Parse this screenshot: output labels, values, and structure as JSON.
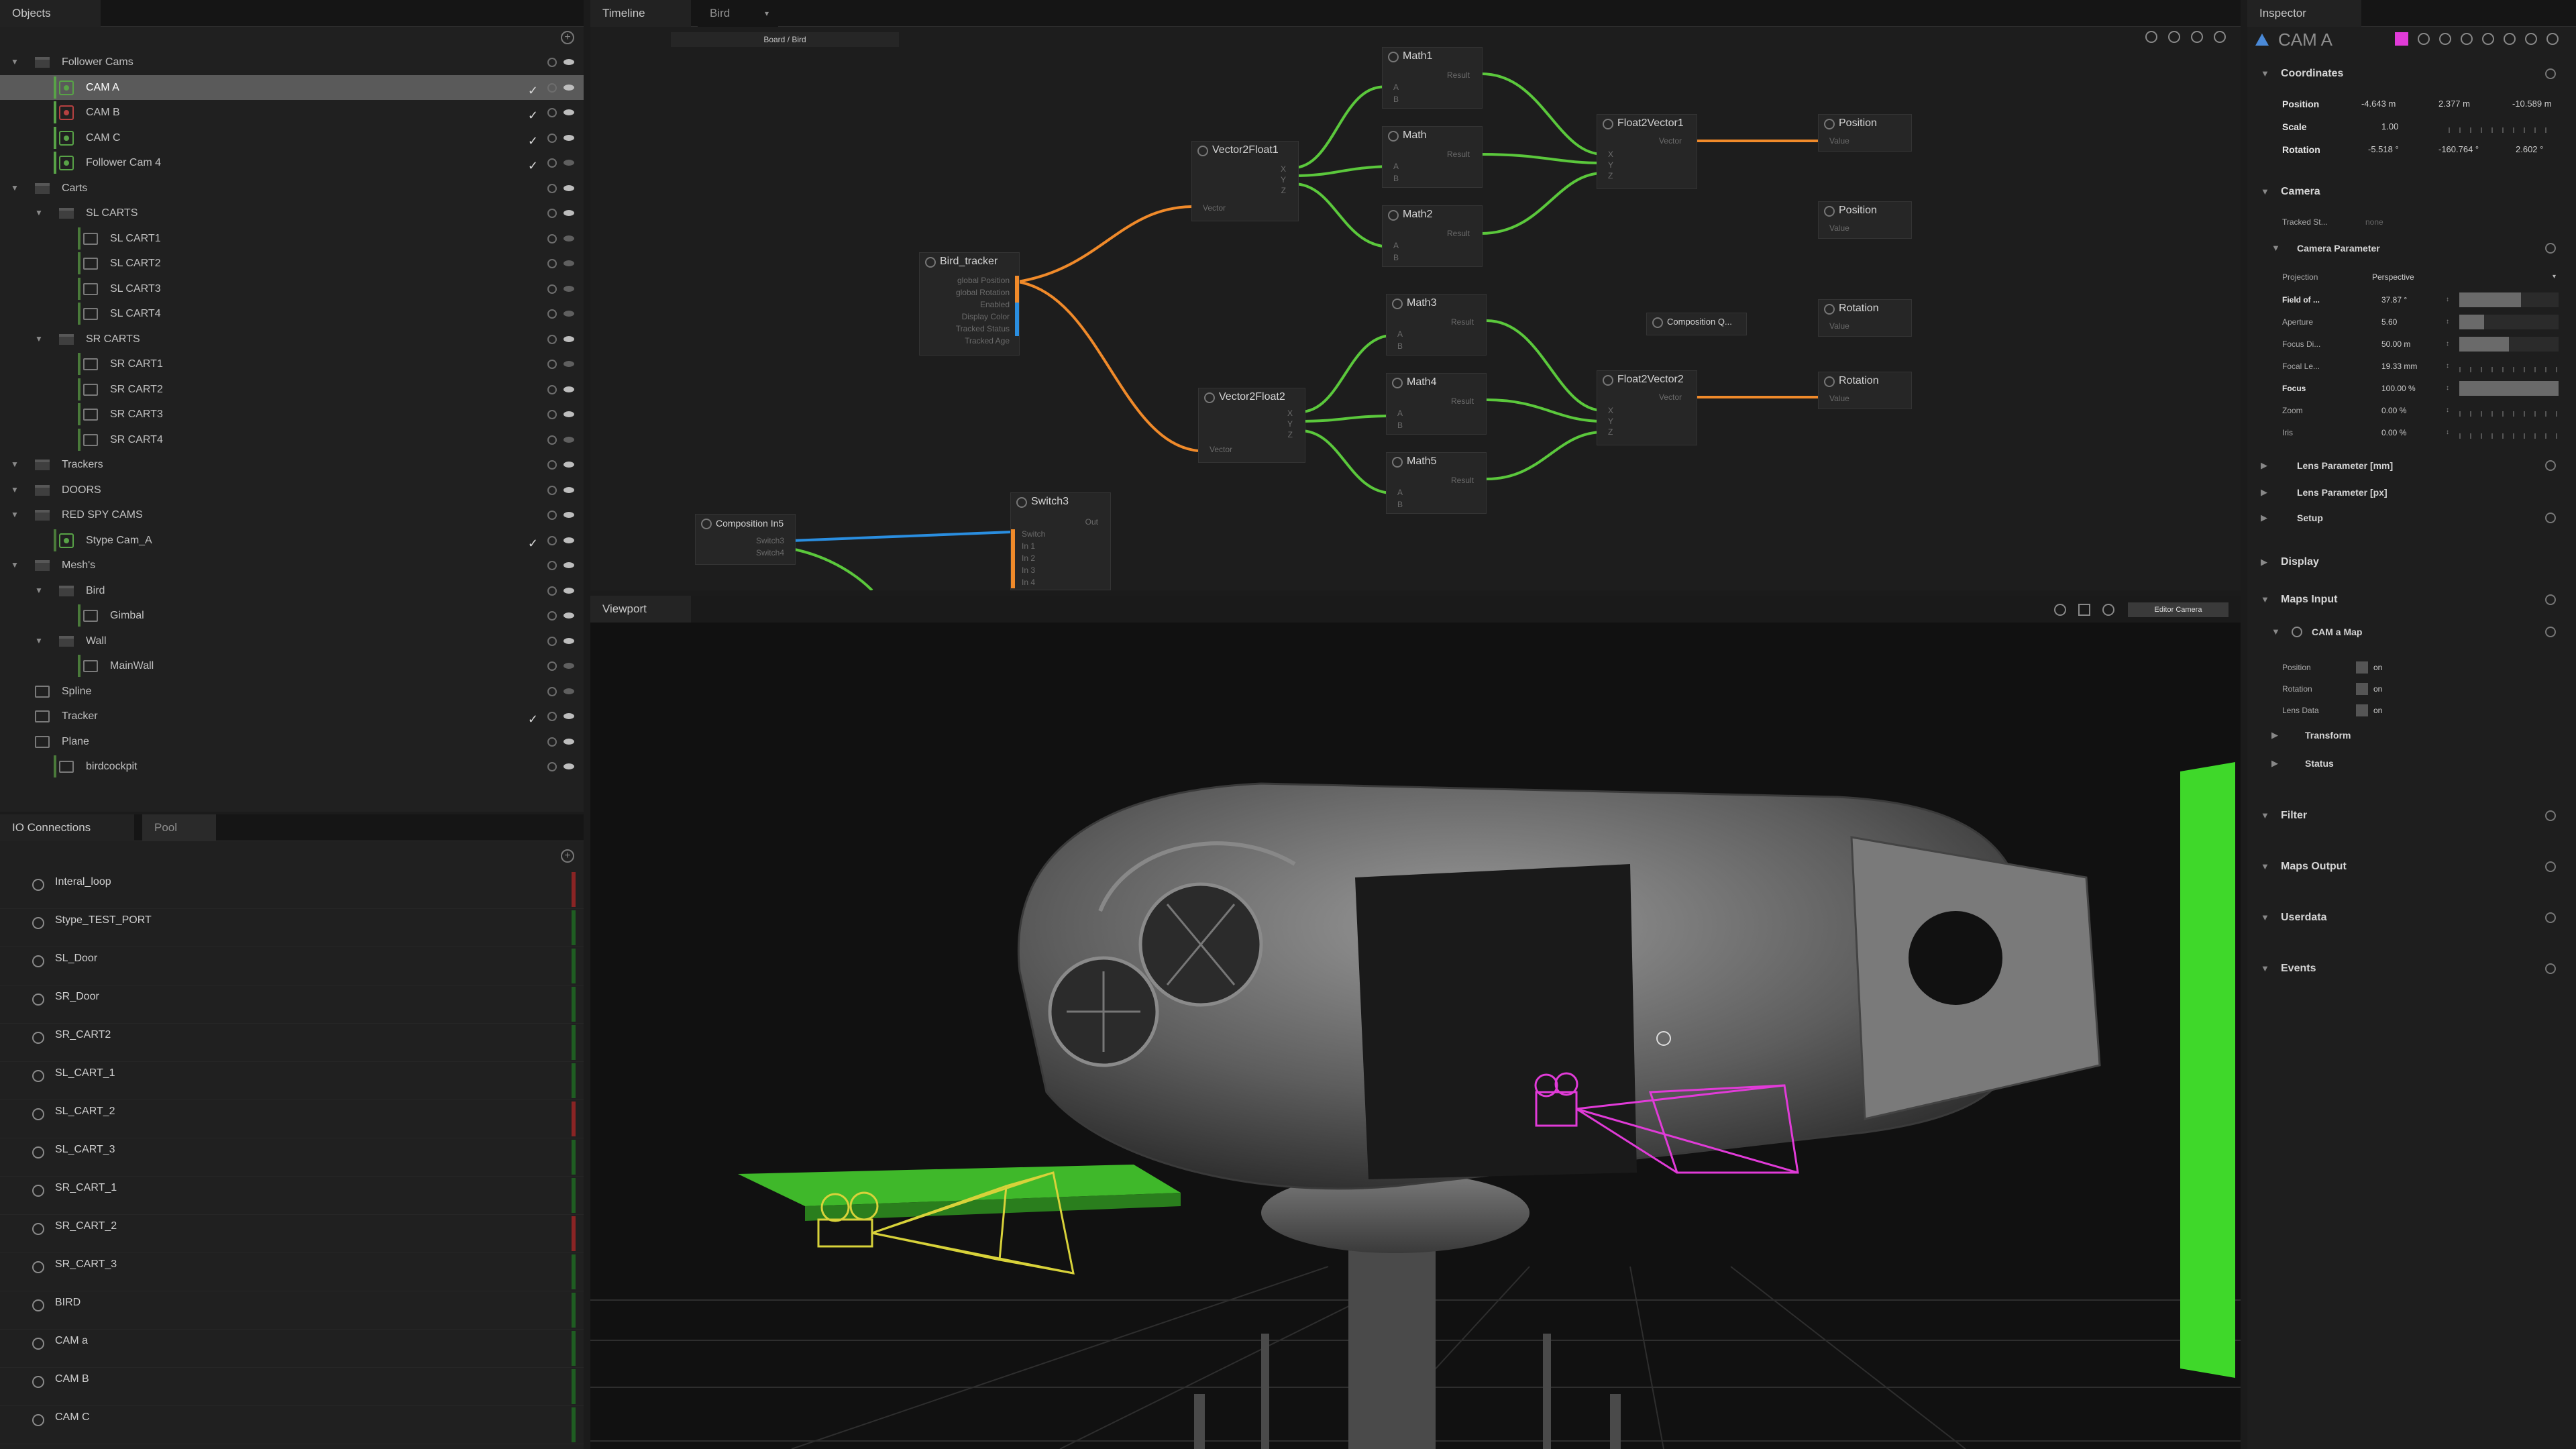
{
  "colors": {
    "accent_orange": "#f08a2a",
    "accent_green": "#5bc83c",
    "accent_blue": "#2a8ee0",
    "magenta": "#e13bd8",
    "selection": "#5a5a5a"
  },
  "objects": {
    "tab_label": "Objects",
    "add_icon": "plus-circle-icon",
    "rows": [
      {
        "label": "Follower Cams",
        "type": "folder"
      },
      {
        "label": "CAM A",
        "type": "camera",
        "selected": true
      },
      {
        "label": "CAM B",
        "type": "camera"
      },
      {
        "label": "CAM C",
        "type": "camera"
      },
      {
        "label": "Follower Cam 4",
        "type": "camera"
      },
      {
        "label": "Carts",
        "type": "folder"
      },
      {
        "label": "SL CARTS",
        "type": "folder"
      },
      {
        "label": "SL CART1",
        "type": "object"
      },
      {
        "label": "SL CART2",
        "type": "object"
      },
      {
        "label": "SL CART3",
        "type": "object"
      },
      {
        "label": "SL CART4",
        "type": "object"
      },
      {
        "label": "SR CARTS",
        "type": "folder"
      },
      {
        "label": "SR CART1",
        "type": "object"
      },
      {
        "label": "SR CART2",
        "type": "object"
      },
      {
        "label": "SR CART3",
        "type": "object"
      },
      {
        "label": "SR CART4",
        "type": "object"
      },
      {
        "label": "Trackers",
        "type": "folder"
      },
      {
        "label": "DOORS",
        "type": "folder"
      },
      {
        "label": "RED SPY CAMS",
        "type": "folder"
      },
      {
        "label": "Stype Cam_A",
        "type": "camera"
      },
      {
        "label": "Mesh's",
        "type": "folder"
      },
      {
        "label": "Bird",
        "type": "folder"
      },
      {
        "label": "Gimbal",
        "type": "object"
      },
      {
        "label": "Wall",
        "type": "folder"
      },
      {
        "label": "MainWall",
        "type": "object"
      },
      {
        "label": "Spline",
        "type": "spline"
      },
      {
        "label": "Tracker",
        "type": "tracker"
      },
      {
        "label": "Plane",
        "type": "plane"
      },
      {
        "label": "birdcockpit",
        "type": "object"
      }
    ]
  },
  "io": {
    "tab_connections": "IO Connections",
    "tab_pool": "Pool",
    "items": [
      {
        "label": "Interal_loop",
        "status": "red"
      },
      {
        "label": "Stype_TEST_PORT",
        "status": "green"
      },
      {
        "label": "SL_Door",
        "status": "green"
      },
      {
        "label": "SR_Door",
        "status": "green"
      },
      {
        "label": "SR_CART2",
        "status": "green"
      },
      {
        "label": "SL_CART_1",
        "status": "green"
      },
      {
        "label": "SL_CART_2",
        "status": "red"
      },
      {
        "label": "SL_CART_3",
        "status": "green"
      },
      {
        "label": "SR_CART_1",
        "status": "green"
      },
      {
        "label": "SR_CART_2",
        "status": "red"
      },
      {
        "label": "SR_CART_3",
        "status": "green"
      },
      {
        "label": "BIRD",
        "status": "green"
      },
      {
        "label": "CAM a",
        "status": "green"
      },
      {
        "label": "CAM B",
        "status": "green"
      },
      {
        "label": "CAM C",
        "status": "green"
      }
    ]
  },
  "timeline": {
    "tab_timeline": "Timeline",
    "tab_bird": "Bird",
    "breadcrumb": "Board / Bird",
    "nodes": {
      "math1": {
        "title": "Math1",
        "port_a": "A",
        "port_b": "B",
        "result": "Result"
      },
      "math": {
        "title": "Math",
        "port_a": "A",
        "port_b": "B",
        "result": "Result"
      },
      "math2": {
        "title": "Math2",
        "port_a": "A",
        "port_b": "B",
        "result": "Result"
      },
      "math3": {
        "title": "Math3",
        "port_a": "A",
        "port_b": "B",
        "result": "Result"
      },
      "math4": {
        "title": "Math4",
        "port_a": "A",
        "port_b": "B",
        "result": "Result"
      },
      "math5": {
        "title": "Math5",
        "port_a": "A",
        "port_b": "B",
        "result": "Result"
      },
      "v2f1": {
        "title": "Vector2Float1",
        "port": "Vector",
        "x": "X",
        "y": "Y",
        "z": "Z"
      },
      "v2f2": {
        "title": "Vector2Float2",
        "port": "Vector",
        "x": "X",
        "y": "Y",
        "z": "Z"
      },
      "f2v1": {
        "title": "Float2Vector1",
        "x": "X",
        "y": "Y",
        "z": "Z",
        "out": "Vector"
      },
      "f2v2": {
        "title": "Float2Vector2",
        "x": "X",
        "y": "Y",
        "z": "Z",
        "out": "Vector"
      },
      "bird": {
        "title": "Bird_tracker",
        "ports": [
          "global Position",
          "global Rotation",
          "Enabled",
          "Display Color",
          "Tracked Status",
          "Tracked Age"
        ]
      },
      "pos1": {
        "title": "Position",
        "value": "Value"
      },
      "pos2": {
        "title": "Position",
        "value": "Value"
      },
      "rot1": {
        "title": "Rotation",
        "value": "Value"
      },
      "rot2": {
        "title": "Rotation",
        "value": "Value"
      },
      "comp_q": {
        "title": "Composition Q..."
      },
      "comp_in": {
        "title": "Composition In5",
        "ports": [
          "Switch3",
          "Switch4"
        ]
      },
      "switch3": {
        "title": "Switch3",
        "out": "Out",
        "ports": [
          "Switch",
          "In 1",
          "In 2",
          "In 3",
          "In 4"
        ]
      }
    }
  },
  "viewport": {
    "tab_label": "Viewport",
    "camera_button": "Editor Camera"
  },
  "inspector": {
    "tab_label": "Inspector",
    "object_name": "CAM A",
    "coordinates": {
      "title": "Coordinates",
      "position": {
        "label": "Position",
        "x": "-4.643 m",
        "y": "2.377 m",
        "z": "-10.589 m"
      },
      "scale": {
        "label": "Scale",
        "x": "1.00"
      },
      "rotation": {
        "label": "Rotation",
        "x": "-5.518 °",
        "y": "-160.764 °",
        "z": "2.602 °"
      }
    },
    "camera": {
      "title": "Camera",
      "tracked_label": "Tracked St...",
      "tracked_value": "none"
    },
    "camera_parameter": {
      "title": "Camera Parameter",
      "projection": {
        "label": "Projection",
        "value": "Perspective"
      },
      "fov": {
        "label": "Field of ...",
        "value": "37.87 °",
        "fill": 0.62
      },
      "aperture": {
        "label": "Aperture",
        "value": "5.60",
        "fill": 0.25
      },
      "focus_d": {
        "label": "Focus Di...",
        "value": "50.00 m",
        "fill": 0.5
      },
      "focal": {
        "label": "Focal Le...",
        "value": "19.33 mm"
      },
      "focus": {
        "label": "Focus",
        "value": "100.00 %",
        "fill": 1.0
      },
      "zoom": {
        "label": "Zoom",
        "value": "0.00 %"
      },
      "iris": {
        "label": "Iris",
        "value": "0.00 %"
      }
    },
    "lens_mm": "Lens Parameter [mm]",
    "lens_px": "Lens Parameter [px]",
    "setup": "Setup",
    "display": "Display",
    "maps_input": "Maps Input",
    "cam_map": {
      "title": "CAM a Map",
      "position": "Position",
      "rotation": "Rotation",
      "lens": "Lens Data",
      "on": "on"
    },
    "transform": "Transform",
    "status": "Status",
    "filter": "Filter",
    "maps_output": "Maps Output",
    "userdata": "Userdata",
    "events": "Events"
  }
}
